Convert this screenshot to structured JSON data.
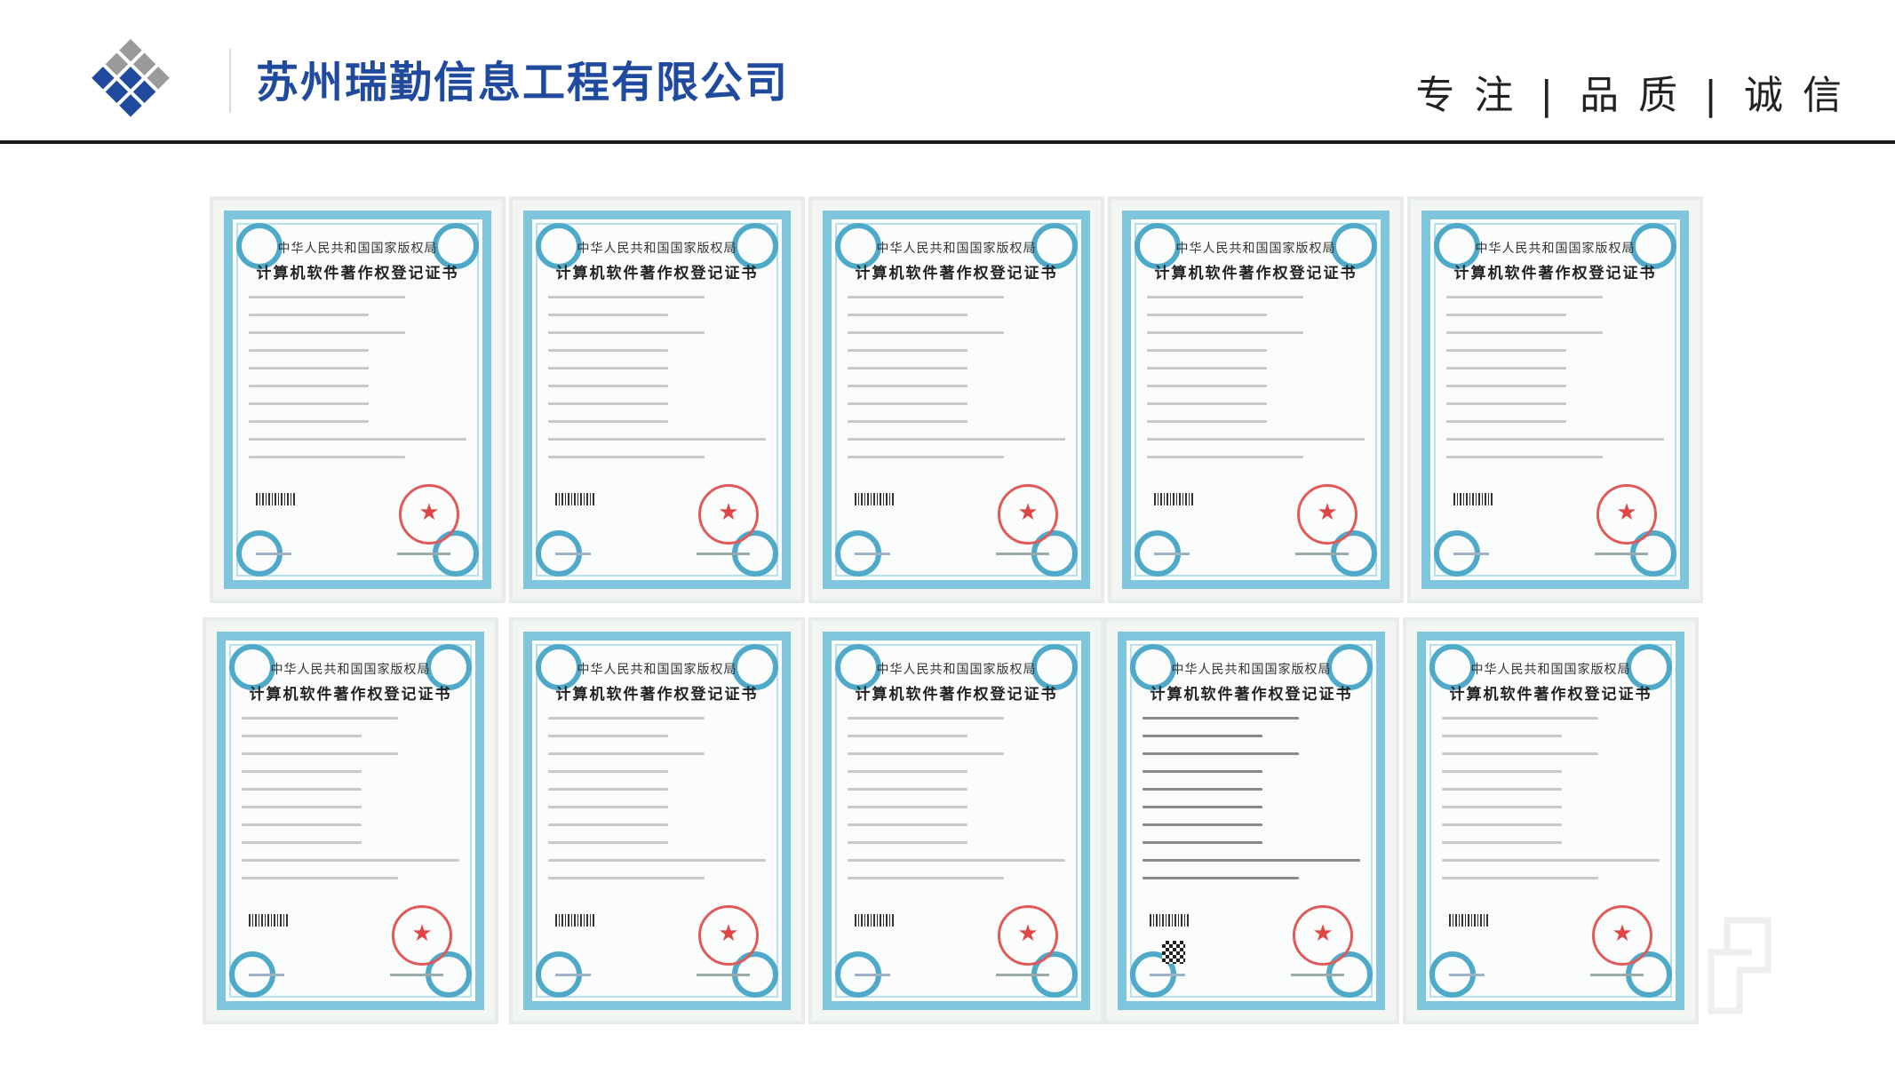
{
  "header": {
    "company_name": "苏州瑞勤信息工程有限公司",
    "slogan": [
      "专注",
      "品质",
      "诚信"
    ],
    "slogan_separator": "|"
  },
  "colors": {
    "brand_blue": "#1f4a9e",
    "logo_gray": "#9a9a9a",
    "certificate_border": "#7fc6dd",
    "seal_red": "#e04646"
  },
  "certificates": [
    {
      "issuer": "中华人民共和国国家版权局",
      "title": "计算机软件著作权登记证书"
    },
    {
      "issuer": "中华人民共和国国家版权局",
      "title": "计算机软件著作权登记证书"
    },
    {
      "issuer": "中华人民共和国国家版权局",
      "title": "计算机软件著作权登记证书"
    },
    {
      "issuer": "中华人民共和国国家版权局",
      "title": "计算机软件著作权登记证书"
    },
    {
      "issuer": "中华人民共和国国家版权局",
      "title": "计算机软件著作权登记证书"
    },
    {
      "issuer": "中华人民共和国国家版权局",
      "title": "计算机软件著作权登记证书"
    },
    {
      "issuer": "中华人民共和国国家版权局",
      "title": "计算机软件著作权登记证书"
    },
    {
      "issuer": "中华人民共和国国家版权局",
      "title": "计算机软件著作权登记证书"
    },
    {
      "issuer": "中华人民共和国国家版权局",
      "title": "计算机软件著作权登记证书"
    },
    {
      "issuer": "中华人民共和国国家版权局",
      "title": "计算机软件著作权登记证书"
    }
  ],
  "icons": {
    "logo": "diamond-grid-logo-icon",
    "watermark": "bracket-watermark-icon"
  }
}
